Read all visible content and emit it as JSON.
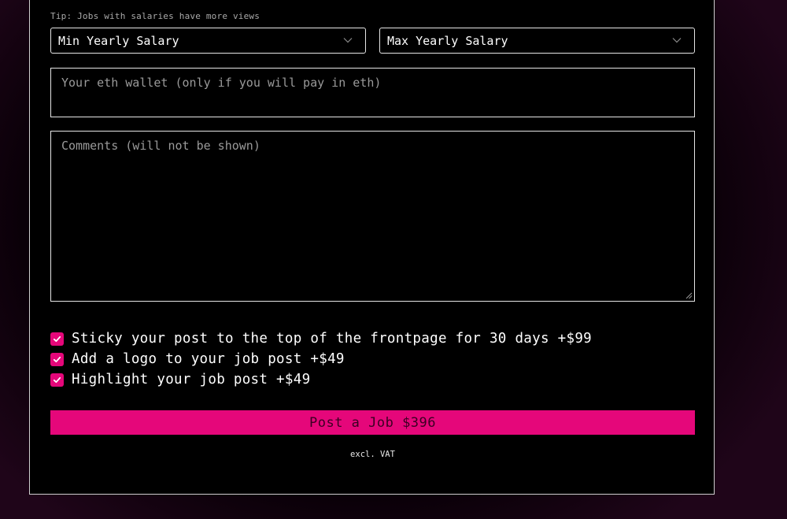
{
  "tip": "Tip: Jobs with salaries have more views",
  "salary": {
    "min_label": "Min Yearly Salary",
    "max_label": "Max Yearly Salary",
    "chevron_icon": "chevron-down-icon"
  },
  "wallet": {
    "placeholder": "Your eth wallet (only if you will pay in eth)",
    "value": ""
  },
  "comments": {
    "placeholder": "Comments (will not be shown)",
    "value": ""
  },
  "options": [
    {
      "label": "Sticky your post to the top of the frontpage for 30 days +$99",
      "checked": true
    },
    {
      "label": "Add a logo to your job post +$49",
      "checked": true
    },
    {
      "label": "Highlight your job post +$49",
      "checked": true
    }
  ],
  "submit": {
    "label": "Post a Job $396",
    "note": "excl. VAT"
  },
  "colors": {
    "accent": "#e5077a",
    "background": "#000000",
    "border": "#e6e6e6",
    "button_text": "#3a0022"
  }
}
